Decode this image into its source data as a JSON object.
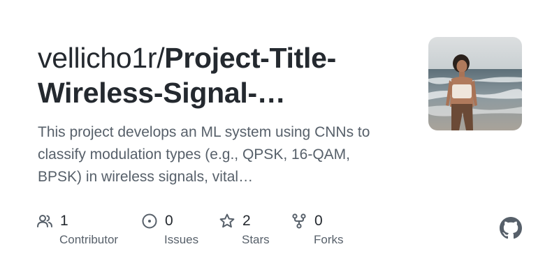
{
  "repo": {
    "owner": "vellicho1r/",
    "name_line1": "Project-Title-",
    "name_line2": "Wireless-Signal-…"
  },
  "description": {
    "line1": "This project develops an ML system using CNNs to",
    "line2": "classify modulation types (e.g., QPSK, 16-QAM,",
    "line3": "BPSK) in wireless signals, vital…"
  },
  "stats": [
    {
      "icon": "people-icon",
      "count": "1",
      "label": "Contributor"
    },
    {
      "icon": "issue-icon",
      "count": "0",
      "label": "Issues"
    },
    {
      "icon": "star-icon",
      "count": "2",
      "label": "Stars"
    },
    {
      "icon": "fork-icon",
      "count": "0",
      "label": "Forks"
    }
  ],
  "colors": {
    "title": "#24292f",
    "muted": "#57606a",
    "icon": "#57606a"
  }
}
